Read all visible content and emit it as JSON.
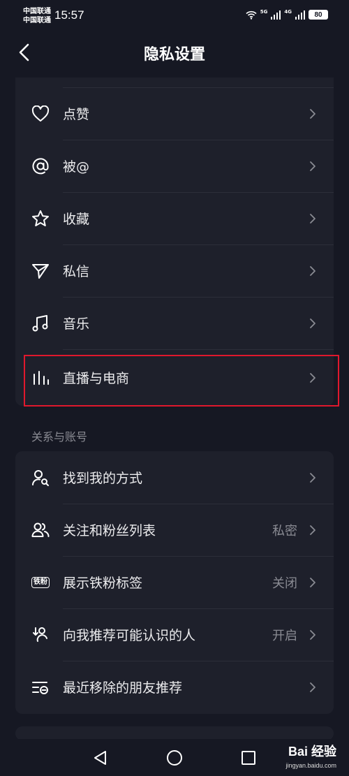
{
  "status_bar": {
    "carrier_1": "中国联通",
    "carrier_2": "中国联通",
    "time": "15:57",
    "signal_1": "5G",
    "signal_2": "4G",
    "battery": "80"
  },
  "nav": {
    "title": "隐私设置"
  },
  "interaction_rows": [
    {
      "label": "点赞",
      "icon": "heart-icon"
    },
    {
      "label": "被@",
      "icon": "at-icon"
    },
    {
      "label": "收藏",
      "icon": "star-icon"
    },
    {
      "label": "私信",
      "icon": "send-icon"
    },
    {
      "label": "音乐",
      "icon": "music-icon"
    },
    {
      "label": "直播与电商",
      "icon": "live-bars-icon"
    }
  ],
  "section_relations": {
    "title": "关系与账号",
    "rows": [
      {
        "label": "找到我的方式",
        "value": "",
        "icon": "user-search-icon"
      },
      {
        "label": "关注和粉丝列表",
        "value": "私密",
        "icon": "users-icon"
      },
      {
        "label": "展示铁粉标签",
        "value": "关闭",
        "icon": "fan-badge-icon"
      },
      {
        "label": "向我推荐可能认识的人",
        "value": "开启",
        "icon": "recommend-user-icon"
      },
      {
        "label": "最近移除的朋友推荐",
        "value": "",
        "icon": "removed-list-icon"
      }
    ]
  },
  "badge_text": "铁粉",
  "highlight_color": "#e0182d",
  "watermark": {
    "brand": "Bai  经验",
    "site": "jingyan.baidu.com"
  }
}
